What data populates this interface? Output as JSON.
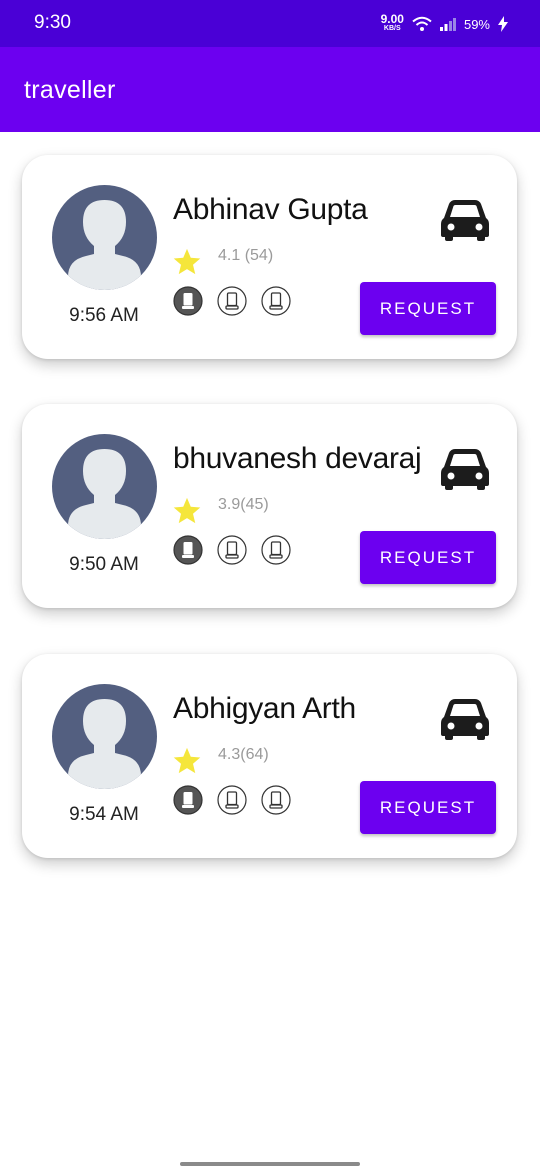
{
  "status_bar": {
    "time": "9:30",
    "net_speed_value": "9.00",
    "net_speed_unit": "KB/S",
    "battery": "59%"
  },
  "app_bar": {
    "title": "traveller"
  },
  "drivers": [
    {
      "name": "Abhinav Gupta",
      "rating": "4.1 (54)",
      "time": "9:56 AM",
      "button": "REQUEST"
    },
    {
      "name": "bhuvanesh devaraj",
      "rating": "3.9(45)",
      "time": "9:50 AM",
      "button": "REQUEST"
    },
    {
      "name": "Abhigyan Arth",
      "rating": "4.3(64)",
      "time": "9:54 AM",
      "button": "REQUEST"
    }
  ],
  "icons": {
    "vehicle": "car-icon",
    "rating": "star-icon",
    "seat_filled": "seat-filled-icon",
    "seat_empty": "seat-empty-icon"
  },
  "colors": {
    "status_bar": "#4a00d6",
    "primary": "#6c00f0",
    "avatar": "#535f80",
    "star": "#f5e63b"
  }
}
